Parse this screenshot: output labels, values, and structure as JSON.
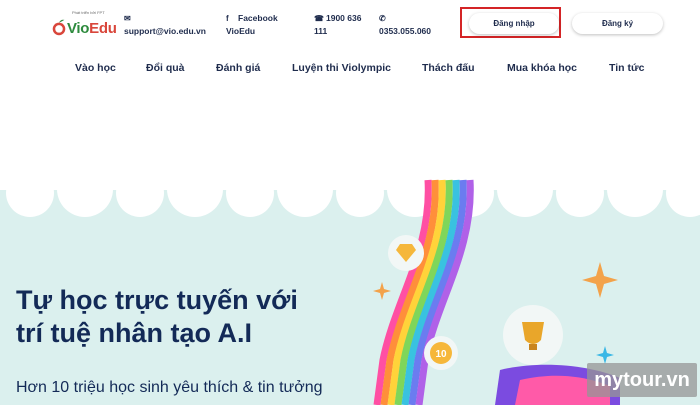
{
  "header": {
    "logo": {
      "tagline": "Phát triển bởi FPT",
      "brand_vio": "Vio",
      "brand_edu": "Edu"
    },
    "contacts": {
      "email": "support@vio.edu.vn",
      "facebook_line1": "Facebook",
      "facebook_line2": "VioEdu",
      "phone1_line1": "1900 636",
      "phone1_line2": "111",
      "phone2": "0353.055.060"
    },
    "login_label": "Đăng nhập",
    "register_label": "Đăng ký"
  },
  "nav": {
    "items": [
      "Vào học",
      "Đổi quà",
      "Đánh giá",
      "Luyện thi Violympic",
      "Thách đấu",
      "Mua khóa học",
      "Tin tức"
    ]
  },
  "hero": {
    "title_line1": "Tự học trực tuyến với",
    "title_line2": "trí tuệ nhân tạo A.I",
    "subtitle": "Hơn 10 triệu học sinh yêu thích & tin tưởng",
    "badge_number": "10"
  },
  "watermark": "mytour.vn",
  "colors": {
    "navy": "#1f2c4d",
    "hero_bg": "#dbf0ee",
    "highlight_box": "#d42426",
    "brand_green": "#2e8b3e",
    "brand_red": "#d9463b"
  }
}
